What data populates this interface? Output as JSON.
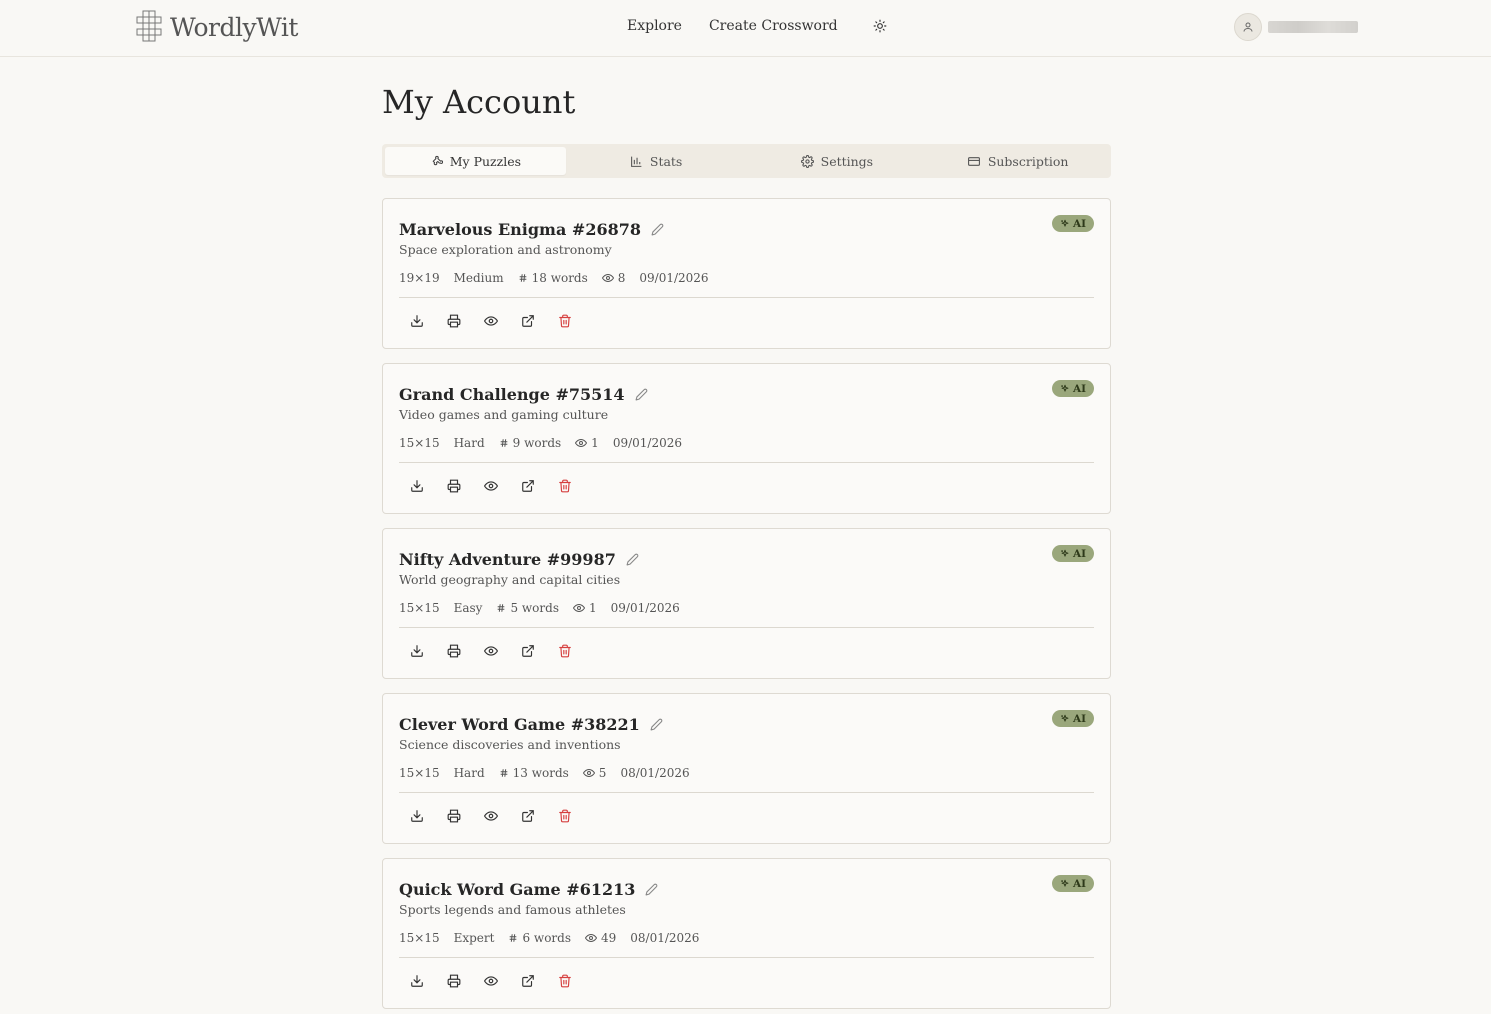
{
  "header": {
    "logo_text": "WordlyWit",
    "nav": [
      {
        "label": "Explore"
      },
      {
        "label": "Create Crossword"
      }
    ]
  },
  "page": {
    "title": "My Account"
  },
  "tabs": [
    {
      "label": "My Puzzles",
      "icon": "puzzle-icon",
      "active": true
    },
    {
      "label": "Stats",
      "icon": "bar-chart-icon",
      "active": false
    },
    {
      "label": "Settings",
      "icon": "gear-icon",
      "active": false
    },
    {
      "label": "Subscription",
      "icon": "credit-card-icon",
      "active": false
    }
  ],
  "puzzles": [
    {
      "title": "Marvelous Enigma #26878",
      "description": "Space exploration and astronomy",
      "size": "19×19",
      "difficulty": "Medium",
      "words": "18 words",
      "views": "8",
      "date": "09/01/2026",
      "badge": "AI"
    },
    {
      "title": "Grand Challenge #75514",
      "description": "Video games and gaming culture",
      "size": "15×15",
      "difficulty": "Hard",
      "words": "9 words",
      "views": "1",
      "date": "09/01/2026",
      "badge": "AI"
    },
    {
      "title": "Nifty Adventure #99987",
      "description": "World geography and capital cities",
      "size": "15×15",
      "difficulty": "Easy",
      "words": "5 words",
      "views": "1",
      "date": "09/01/2026",
      "badge": "AI"
    },
    {
      "title": "Clever Word Game #38221",
      "description": "Science discoveries and inventions",
      "size": "15×15",
      "difficulty": "Hard",
      "words": "13 words",
      "views": "5",
      "date": "08/01/2026",
      "badge": "AI"
    },
    {
      "title": "Quick Word Game #61213",
      "description": "Sports legends and famous athletes",
      "size": "15×15",
      "difficulty": "Expert",
      "words": "6 words",
      "views": "49",
      "date": "08/01/2026",
      "badge": "AI"
    }
  ],
  "colors": {
    "background": "#f9f8f5",
    "badge": "#9aa77c",
    "delete": "#d64040"
  }
}
